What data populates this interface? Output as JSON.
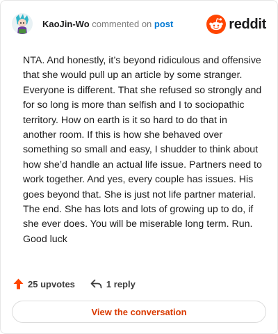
{
  "header": {
    "username": "KaoJin-Wo",
    "action_text": "commented on",
    "post_link": "post",
    "brand_name": "reddit",
    "brand_color": "#ff4500"
  },
  "comment": {
    "body": "NTA. And honestly, it’s beyond ridiculous and offensive that she would pull up an article by some stranger. Everyone is different. That she refused so strongly and for so long is more than selfish and I to sociopathic territory. How on earth is it so hard to do that in another room. If this is how she behaved over something so small and easy, I shudder to think about how she’d handle an actual life issue. Partners need to work together. And yes, every couple has issues. His goes beyond that. She is just not life partner material. The end. She has lots and lots of growing up to do, if she ever does. You will be miserable long term. Run. Good luck"
  },
  "actions": {
    "upvotes_label": "25 upvotes",
    "reply_label": "1 reply",
    "upvote_icon": "upvote-arrow-icon",
    "reply_icon": "reply-arrow-icon"
  },
  "footer": {
    "view_button_label": "View the conversation"
  }
}
